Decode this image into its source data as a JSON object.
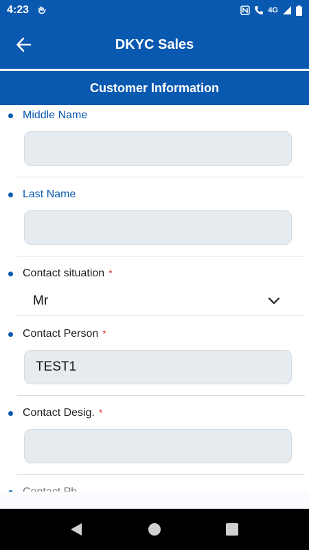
{
  "status_bar": {
    "time": "4:23",
    "network_label": "4G"
  },
  "app_bar": {
    "title": "DKYC Sales"
  },
  "section": {
    "title": "Customer Information"
  },
  "fields": {
    "middle_name": {
      "label": "Middle Name",
      "value": ""
    },
    "last_name": {
      "label": "Last Name",
      "value": ""
    },
    "contact_situation": {
      "label": "Contact situation",
      "required": "*",
      "value": "Mr"
    },
    "contact_person": {
      "label": "Contact Person",
      "required": "*",
      "value": "TEST1"
    },
    "contact_desig": {
      "label": "Contact Desig.",
      "required": "*",
      "value": ""
    },
    "contact_ph": {
      "label": "Contact Ph"
    }
  },
  "colors": {
    "primary": "#0a59b0",
    "required": "#d9302c",
    "input_bg": "#e6ebf0"
  }
}
